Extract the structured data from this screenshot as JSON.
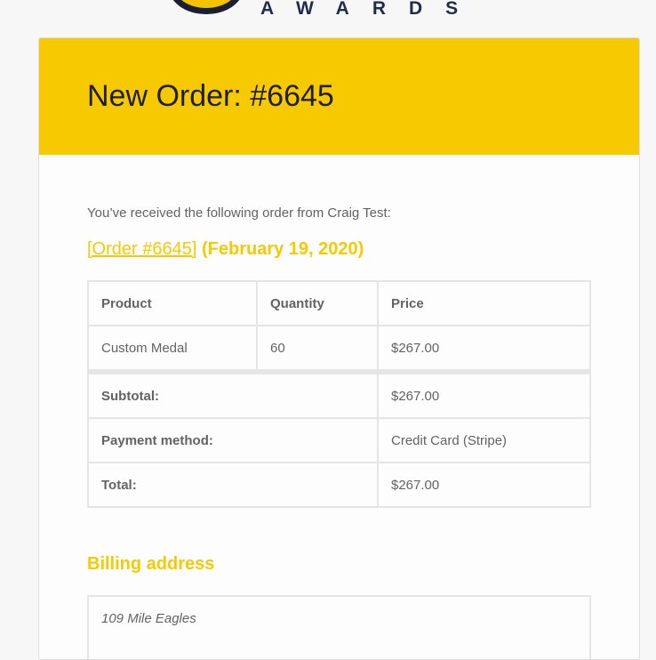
{
  "logo": {
    "text": "AWARDS"
  },
  "header": {
    "title": "New Order: #6645"
  },
  "intro": "You’ve received the following order from Craig Test:",
  "order": {
    "link_label": "[Order #6645]",
    "date": "(February 19, 2020)"
  },
  "table": {
    "headers": [
      "Product",
      "Quantity",
      "Price"
    ],
    "rows": [
      {
        "product": "Custom Medal",
        "quantity": "60",
        "price": "$267.00"
      }
    ],
    "totals": [
      {
        "label": "Subtotal:",
        "value": "$267.00"
      },
      {
        "label": "Payment method:",
        "value": "Credit Card (Stripe)"
      },
      {
        "label": "Total:",
        "value": "$267.00"
      }
    ]
  },
  "billing": {
    "heading": "Billing address",
    "line1": "109 Mile Eagles"
  },
  "colors": {
    "accent": "#f7c900",
    "navy": "#1f2d4d"
  }
}
